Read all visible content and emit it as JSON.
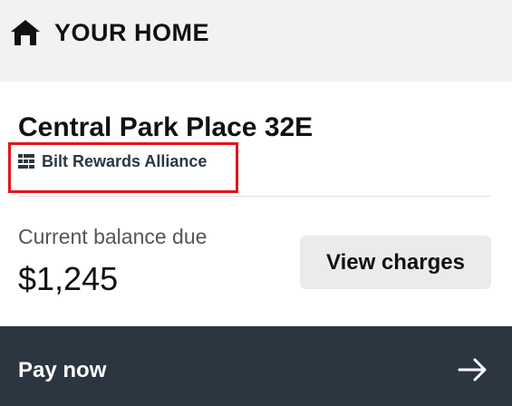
{
  "header": {
    "title": "YOUR HOME",
    "icon": "home-icon"
  },
  "property": {
    "name": "Central Park Place 32E",
    "alliance": "Bilt Rewards Alliance",
    "alliance_icon": "building-icon"
  },
  "balance": {
    "label": "Current balance due",
    "amount": "$1,245"
  },
  "actions": {
    "view_charges_label": "View charges",
    "pay_now_label": "Pay now",
    "pay_now_icon": "arrow-right-icon"
  },
  "colors": {
    "page_background": "#f2f2f2",
    "card_background": "#ffffff",
    "pay_bar": "#2b3640",
    "highlight": "#e3141c",
    "secondary_button": "#ebebeb"
  }
}
